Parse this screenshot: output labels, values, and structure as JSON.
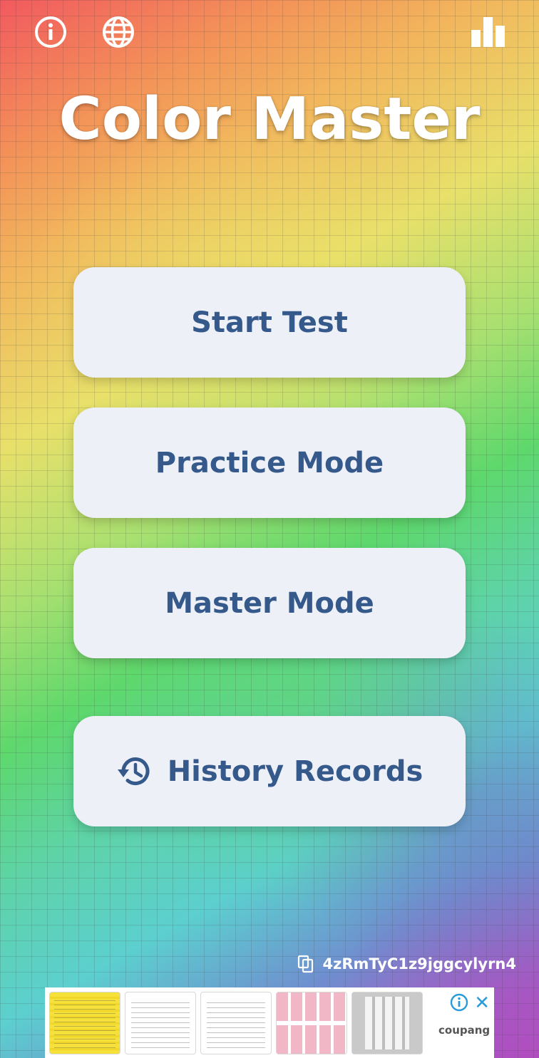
{
  "app": {
    "title": "Color Master"
  },
  "topbar": {
    "icons": [
      "info-icon",
      "globe-icon",
      "bar-chart-icon"
    ]
  },
  "menu": {
    "start_test": "Start Test",
    "practice_mode": "Practice Mode",
    "master_mode": "Master Mode",
    "history_records": "History Records",
    "history_icon": "history-icon"
  },
  "user_code": {
    "value": "4zRmTyC1z9jggcylyrn4",
    "icon": "copy-icon"
  },
  "ad": {
    "brand": "coupang",
    "icons": [
      "ad-info-icon",
      "ad-close-icon"
    ]
  },
  "colors": {
    "button_bg": "#eef0f8",
    "button_text": "#34598a",
    "title_text": "#ffffff"
  }
}
